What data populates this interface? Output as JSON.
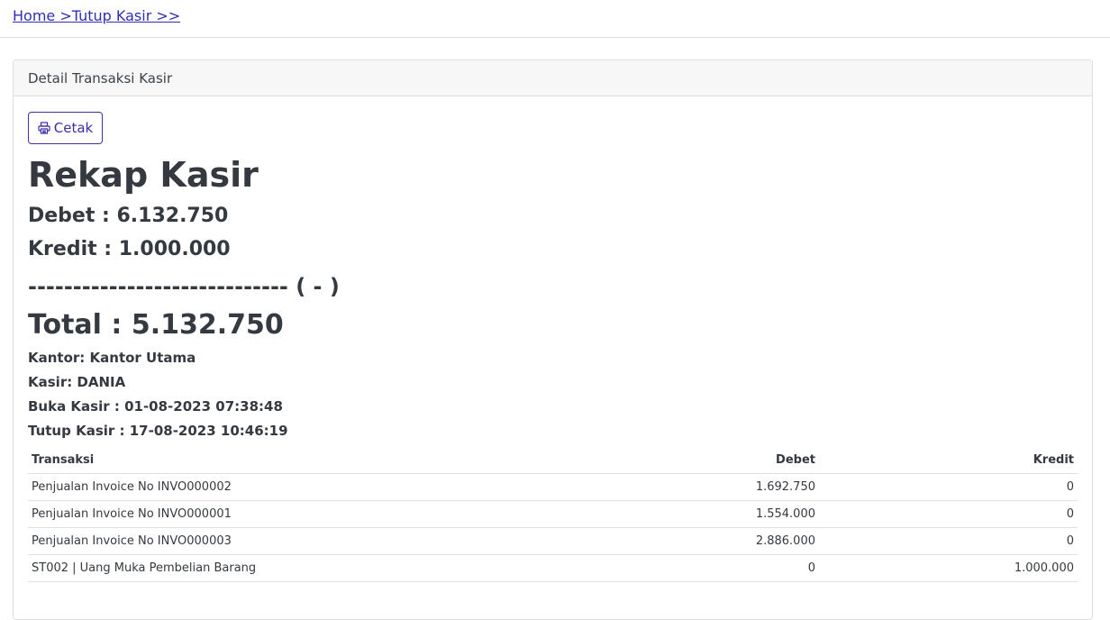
{
  "breadcrumb": {
    "home": "Home >",
    "current": "Tutup Kasir >>"
  },
  "card": {
    "header": "Detail Transaksi Kasir",
    "print_button": "Cetak",
    "print_icon": "printer-icon"
  },
  "rekap": {
    "title": "Rekap Kasir",
    "debet_label": "Debet : ",
    "debet_value": "6.132.750",
    "kredit_label": "Kredit : ",
    "kredit_value": "1.000.000",
    "divider": "----------------------------- ( - )",
    "total_label": "Total : ",
    "total_value": "5.132.750"
  },
  "info": {
    "kantor": "Kantor: Kantor Utama",
    "kasir": "Kasir: DANIA",
    "buka": "Buka Kasir : 01-08-2023 07:38:48",
    "tutup": "Tutup Kasir : 17-08-2023 10:46:19"
  },
  "table": {
    "headers": [
      "Transaksi",
      "Debet",
      "Kredit"
    ],
    "rows": [
      [
        "Penjualan Invoice No INVO000002",
        "1.692.750",
        "0"
      ],
      [
        "Penjualan Invoice No INVO000001",
        "1.554.000",
        "0"
      ],
      [
        "Penjualan Invoice No INVO000003",
        "2.886.000",
        "0"
      ],
      [
        "ST002 | Uang Muka Pembelian Barang",
        "0",
        "1.000.000"
      ]
    ]
  },
  "colors": {
    "link": "#2e2eb8",
    "button_border": "#4b2aa3",
    "text": "#343a40"
  }
}
